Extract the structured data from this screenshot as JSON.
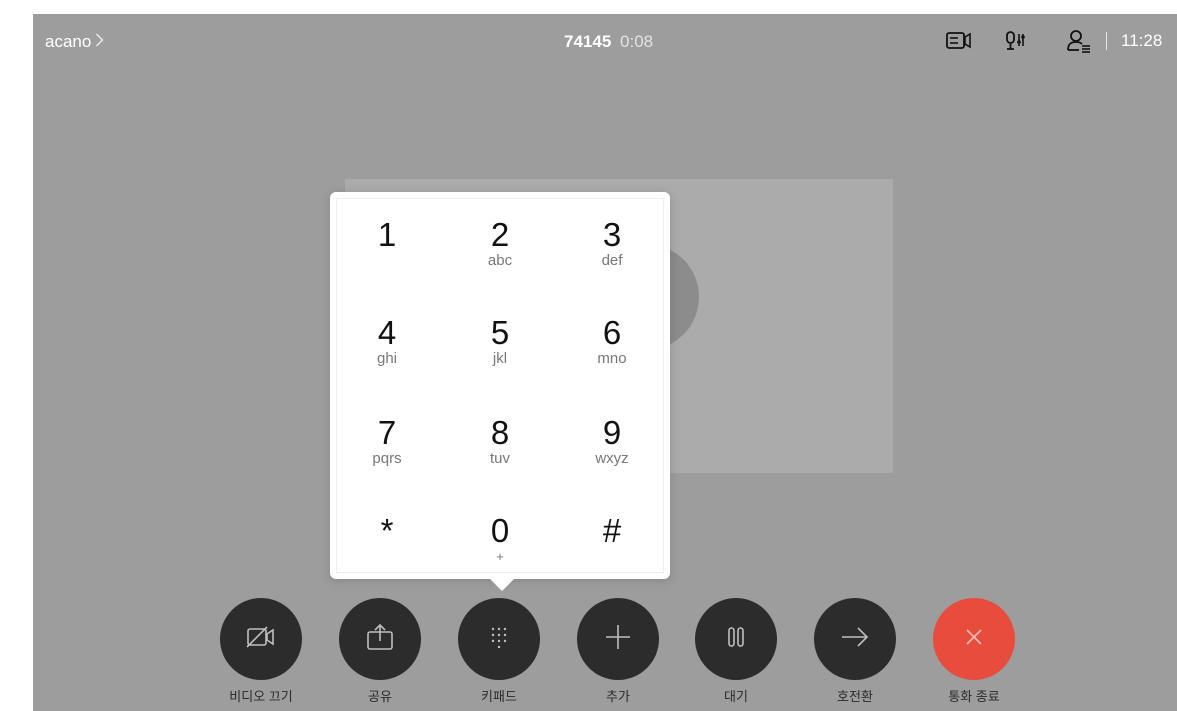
{
  "topbar": {
    "breadcrumb": "acano",
    "breadcrumb_chevron": "chevron-right-icon",
    "call_number": "74145",
    "call_timer": "0:08",
    "icons": [
      "video-layout-icon",
      "microphone-settings-icon",
      "participants-icon"
    ],
    "clock": "11:28"
  },
  "keypad": {
    "keys": [
      {
        "digit": "1",
        "letters": ""
      },
      {
        "digit": "2",
        "letters": "abc"
      },
      {
        "digit": "3",
        "letters": "def"
      },
      {
        "digit": "4",
        "letters": "ghi"
      },
      {
        "digit": "5",
        "letters": "jkl"
      },
      {
        "digit": "6",
        "letters": "mno"
      },
      {
        "digit": "7",
        "letters": "pqrs"
      },
      {
        "digit": "8",
        "letters": "tuv"
      },
      {
        "digit": "9",
        "letters": "wxyz"
      },
      {
        "digit": "*",
        "letters": ""
      },
      {
        "digit": "0",
        "letters": "+"
      },
      {
        "digit": "#",
        "letters": ""
      }
    ]
  },
  "controls": [
    {
      "label": "비디오 끄기",
      "icon": "video-off-icon"
    },
    {
      "label": "공유",
      "icon": "share-icon"
    },
    {
      "label": "키패드",
      "icon": "keypad-icon"
    },
    {
      "label": "추가",
      "icon": "add-icon"
    },
    {
      "label": "대기",
      "icon": "hold-icon"
    },
    {
      "label": "호전환",
      "icon": "transfer-icon"
    },
    {
      "label": "통화 종료",
      "icon": "end-call-icon"
    }
  ],
  "colors": {
    "background": "#9d9d9d",
    "control_button": "#2c2c2c",
    "end_call": "#e74c3c"
  }
}
